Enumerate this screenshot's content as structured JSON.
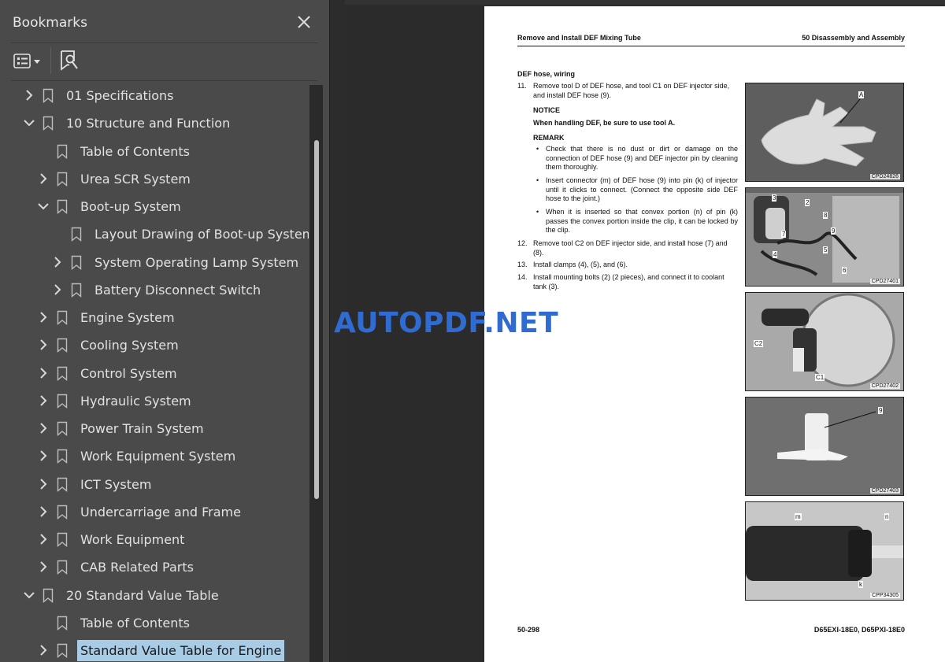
{
  "sidebar": {
    "title": "Bookmarks",
    "items": [
      {
        "label": "01 Specifications",
        "level": 0,
        "toggle": "collapsed"
      },
      {
        "label": "10 Structure and Function",
        "level": 0,
        "toggle": "expanded"
      },
      {
        "label": "Table of Contents",
        "level": 1,
        "toggle": "none"
      },
      {
        "label": "Urea SCR System",
        "level": 1,
        "toggle": "collapsed"
      },
      {
        "label": "Boot-up System",
        "level": 1,
        "toggle": "expanded"
      },
      {
        "label": "Layout Drawing of Boot-up System",
        "level": 2,
        "toggle": "none"
      },
      {
        "label": "System Operating Lamp System",
        "level": 2,
        "toggle": "collapsed"
      },
      {
        "label": "Battery Disconnect Switch",
        "level": 2,
        "toggle": "collapsed"
      },
      {
        "label": "Engine System",
        "level": 1,
        "toggle": "collapsed"
      },
      {
        "label": "Cooling System",
        "level": 1,
        "toggle": "collapsed"
      },
      {
        "label": "Control System",
        "level": 1,
        "toggle": "collapsed"
      },
      {
        "label": "Hydraulic System",
        "level": 1,
        "toggle": "collapsed"
      },
      {
        "label": "Power Train System",
        "level": 1,
        "toggle": "collapsed"
      },
      {
        "label": "Work Equipment System",
        "level": 1,
        "toggle": "collapsed"
      },
      {
        "label": "ICT System",
        "level": 1,
        "toggle": "collapsed"
      },
      {
        "label": "Undercarriage and Frame",
        "level": 1,
        "toggle": "collapsed"
      },
      {
        "label": "Work Equipment",
        "level": 1,
        "toggle": "collapsed"
      },
      {
        "label": "CAB Related Parts",
        "level": 1,
        "toggle": "collapsed"
      },
      {
        "label": "20 Standard Value Table",
        "level": 0,
        "toggle": "expanded"
      },
      {
        "label": "Table of Contents",
        "level": 1,
        "toggle": "none"
      },
      {
        "label": "Standard Value Table for Engine",
        "level": 1,
        "toggle": "collapsed",
        "selected": true
      }
    ]
  },
  "page": {
    "header_left": "Remove and Install DEF Mixing Tube",
    "header_right": "50 Disassembly and Assembly",
    "section_title": "DEF hose, wiring",
    "step11_num": "11.",
    "step11": "Remove tool D of DEF hose, and tool C1 on DEF injector side, and install DEF hose (9).",
    "notice_label": "NOTICE",
    "notice_text": "When handling DEF, be sure to use tool A.",
    "remark_label": "REMARK",
    "bullets": [
      "Check that there is no dust or dirt or damage on the connection of DEF hose (9) and DEF injector pin by cleaning them thoroughly.",
      "Insert connector (m) of DEF hose (9) into pin (k) of injector until it clicks to connect. (Connect the opposite side DEF hose to the joint.)",
      "When it is inserted so that convex portion (n) of pin (k) passes the convex portion inside the clip, it can be locked by the clip."
    ],
    "step12_num": "12.",
    "step12": "Remove tool C2 on DEF injector side, and install hose (7) and (8).",
    "step13_num": "13.",
    "step13": "Install clamps (4), (5), and (6).",
    "step14_num": "14.",
    "step14": "Install mounting bolts (2) (2 pieces), and connect it to coolant tank (3).",
    "footer_left": "50-298",
    "footer_right": "D65EXI-18E0, D65PXI-18E0",
    "photos": [
      {
        "code": "CPD24826",
        "callouts": [
          "A"
        ]
      },
      {
        "code": "CPD27401",
        "callouts": [
          "3",
          "2",
          "8",
          "7",
          "9",
          "4",
          "5",
          "6"
        ]
      },
      {
        "code": "CPD27402",
        "callouts": [
          "C2",
          "C1"
        ]
      },
      {
        "code": "CPD27403",
        "callouts": [
          "9"
        ]
      },
      {
        "code": "CPP34305",
        "callouts": [
          "m",
          "n",
          "k"
        ]
      }
    ]
  },
  "watermark": "AUTOPDF.NET",
  "colors": {
    "sidebar_bg": "#4a4a4a",
    "selection": "#a8cbe6",
    "watermark": "#2f6bd1"
  }
}
